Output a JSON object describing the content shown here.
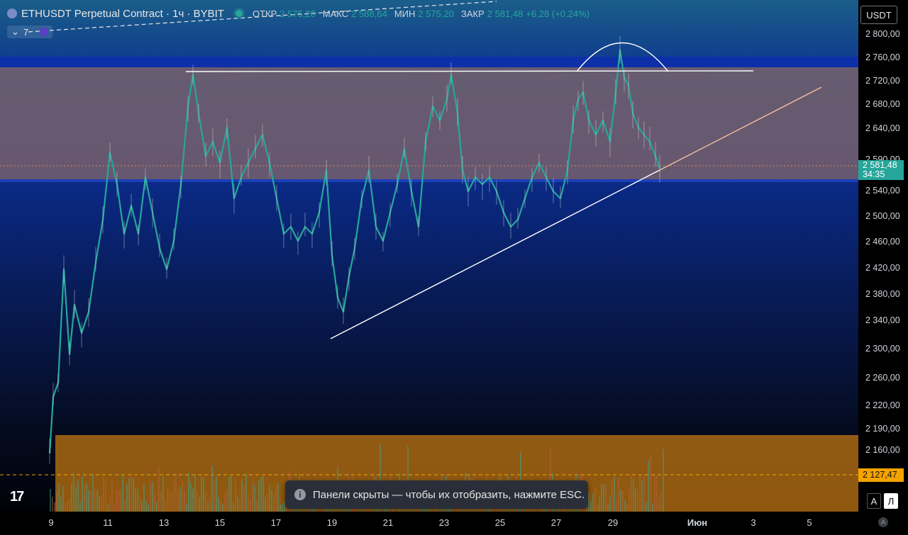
{
  "header": {
    "title": "ETHUSDT Perpetual Contract · 1ч · BYBIT",
    "ohlc": [
      {
        "label": "ОТКР",
        "value": "2 575,20"
      },
      {
        "label": "МАКС",
        "value": "2 588,64"
      },
      {
        "label": "МИН",
        "value": "2 575,20"
      },
      {
        "label": "ЗАКР",
        "value": "2 581,48"
      }
    ],
    "change": "+6,28 (+0,24%)",
    "indicators_count": "7"
  },
  "currency": "USDT",
  "price_axis": {
    "ticks": [
      "2 800,00",
      "2 760,00",
      "2 720,00",
      "2 680,00",
      "2 640,00",
      "2 590,00",
      "2 540,00",
      "2 500,00",
      "2 460,00",
      "2 420,00",
      "2 380,00",
      "2 340,00",
      "2 300,00",
      "2 260,00",
      "2 220,00",
      "2 190,00",
      "2 160,00"
    ],
    "last_price": "2 581,48",
    "countdown": "34:35",
    "level_price": "2 127,47"
  },
  "time_axis": {
    "ticks": [
      "9",
      "11",
      "13",
      "15",
      "17",
      "19",
      "21",
      "23",
      "25",
      "27",
      "29",
      "Июн",
      "3",
      "5"
    ]
  },
  "toast": {
    "message": "Панели скрыты — чтобы их отобразить, нажмите ESC."
  },
  "scale": {
    "auto": "A",
    "log": "Л",
    "settings": "A"
  },
  "colors": {
    "up": "#26a69a",
    "level": "#f5a300",
    "zone": "#8a6a66"
  },
  "icons": {
    "logo": "tradingview-logo-icon",
    "info": "info-icon"
  }
}
